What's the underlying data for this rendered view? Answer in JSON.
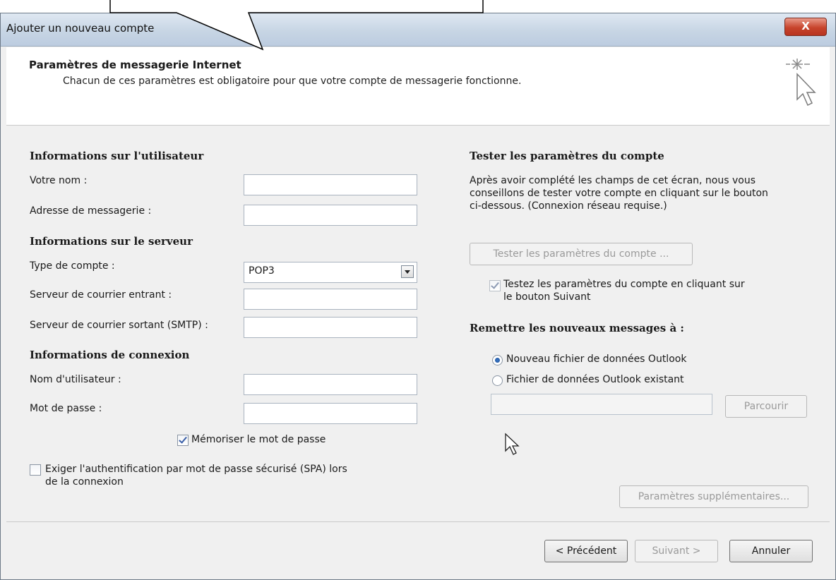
{
  "window": {
    "title": "Ajouter un nouveau compte",
    "close_label": "X"
  },
  "header": {
    "title": "Paramètres de messagerie Internet",
    "subtitle": "Chacun de ces paramètres est obligatoire pour que votre compte de messagerie fonctionne."
  },
  "user_info": {
    "heading": "Informations sur l'utilisateur",
    "name_label": "Votre nom :",
    "name_value": "",
    "email_label": "Adresse de messagerie :",
    "email_value": ""
  },
  "server_info": {
    "heading": "Informations sur le serveur",
    "account_type_label": "Type de compte :",
    "account_type_value": "POP3",
    "incoming_label": "Serveur de courrier entrant :",
    "incoming_value": "",
    "outgoing_label": "Serveur de courrier sortant (SMTP) :",
    "outgoing_value": ""
  },
  "login_info": {
    "heading": "Informations de connexion",
    "username_label": "Nom d'utilisateur :",
    "username_value": "",
    "password_label": "Mot de passe :",
    "password_value": "",
    "remember_label": "Mémoriser le mot de passe",
    "remember_checked": true,
    "spa_label_line1": "Exiger l'authentification par mot de passe sécurisé (SPA) lors",
    "spa_label_line2": "de la connexion",
    "spa_checked": false
  },
  "test_settings": {
    "heading": "Tester les paramètres du compte",
    "desc_line1": "Après avoir complété les champs de cet écran, nous vous",
    "desc_line2": "conseillons de tester votre compte en cliquant sur le bouton",
    "desc_line3": "ci-dessous. (Connexion réseau requise.)",
    "test_button": "Tester les paramètres du compte ...",
    "auto_test_line1": "Testez les paramètres du compte en cliquant sur",
    "auto_test_line2": "le bouton Suivant",
    "auto_test_checked": true
  },
  "deliver": {
    "heading": "Remettre les nouveaux messages à :",
    "option_new": "Nouveau fichier de données Outlook",
    "option_existing": "Fichier de données Outlook existant",
    "selected": "new",
    "browse_button": "Parcourir",
    "more_settings_button": "Paramètres supplémentaires..."
  },
  "footer": {
    "back_button": "< Précédent",
    "next_button": "Suivant >",
    "cancel_button": "Annuler"
  }
}
